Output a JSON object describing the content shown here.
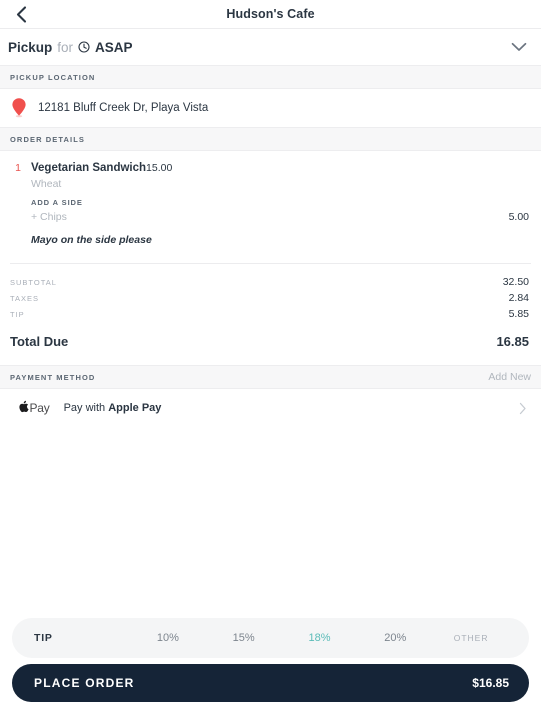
{
  "header": {
    "back_icon": "chevron-left-icon",
    "title": "Hudson's Cafe"
  },
  "fulfillment": {
    "method": "Pickup",
    "connector": "for",
    "clock_icon": "clock-icon",
    "time": "ASAP",
    "expand_icon": "chevron-down-icon"
  },
  "pickup_location": {
    "section_title": "PICKUP LOCATION",
    "pin_icon": "map-pin-icon",
    "address": "12181 Bluff Creek Dr, Playa Vista"
  },
  "order_details": {
    "section_title": "ORDER DETAILS",
    "items": [
      {
        "qty": "1",
        "name": "Vegetarian Sandwich",
        "price": "15.00",
        "option": "Wheat",
        "modifier_group": "ADD A SIDE",
        "modifier_name": "+ Chips",
        "modifier_price": "5.00",
        "note": "Mayo on the side please"
      }
    ]
  },
  "totals": {
    "lines": [
      {
        "label": "SUBTOTAL",
        "value": "32.50"
      },
      {
        "label": "TAXES",
        "value": "2.84"
      },
      {
        "label": "TIP",
        "value": "5.85"
      }
    ],
    "grand_label": "Total Due",
    "grand_value": "16.85"
  },
  "payment": {
    "section_title": "PAYMENT METHOD",
    "add_new": "Add New",
    "apple_logo": "apple-logo-icon",
    "apple_pay_word": "Pay",
    "label_prefix": "Pay with ",
    "label_strong": "Apple Pay",
    "chevron_icon": "chevron-right-icon"
  },
  "tip_selector": {
    "label": "TIP",
    "options": [
      {
        "label": "10%",
        "selected": false
      },
      {
        "label": "15%",
        "selected": false
      },
      {
        "label": "18%",
        "selected": true
      },
      {
        "label": "20%",
        "selected": false
      },
      {
        "label": "OTHER",
        "selected": false
      }
    ],
    "selected_color": "#5bbcb8"
  },
  "place_order": {
    "label": "PLACE ORDER",
    "total": "$16.85",
    "background": "#152437"
  },
  "colors": {
    "accent_red": "#e8534f",
    "teal": "#5bbcb8",
    "dark_navy": "#152437",
    "band_gray": "#f7f7f8"
  }
}
